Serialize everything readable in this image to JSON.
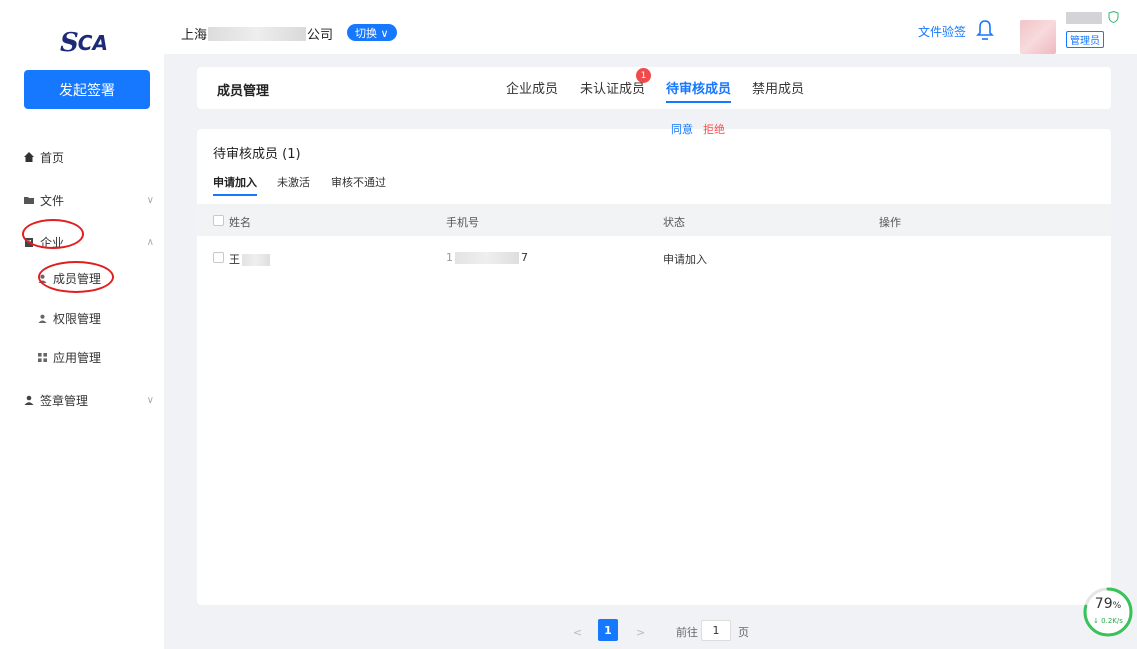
{
  "brand": {
    "logo_mark": "S",
    "logo_text": "CA"
  },
  "sidebar": {
    "start_button": "发起签署",
    "items": [
      {
        "label": "首页",
        "icon": "home-icon"
      },
      {
        "label": "文件",
        "icon": "folder-icon",
        "expand": "chevron-down-icon"
      },
      {
        "label": "企业",
        "icon": "building-icon",
        "expand": "chevron-up-icon"
      },
      {
        "label": "签章管理",
        "icon": "user-icon",
        "expand": "chevron-down-icon"
      }
    ],
    "sub_items": [
      {
        "label": "成员管理",
        "icon": "user-icon"
      },
      {
        "label": "权限管理",
        "icon": "user-icon"
      },
      {
        "label": "应用管理",
        "icon": "grid-icon"
      }
    ]
  },
  "header": {
    "company_prefix": "上海",
    "company_suffix": "公司",
    "switch_label": "切换 ∨",
    "file_verify": "文件验签",
    "role": "管理员"
  },
  "tabs_card": {
    "title": "成员管理",
    "tabs": [
      "企业成员",
      "未认证成员",
      "待审核成员",
      "禁用成员"
    ],
    "active_tab": "待审核成员",
    "badge": "1"
  },
  "panel": {
    "heading": "待审核成员 (1)",
    "subtabs": [
      "申请加入",
      "未激活",
      "审核不通过"
    ],
    "columns": [
      "姓名",
      "手机号",
      "状态",
      "操作"
    ],
    "rows": [
      {
        "name_visible": "王",
        "phone_prefix": "1",
        "phone_suffix": "7",
        "status": "申请加入",
        "agree": "同意",
        "reject": "拒绝"
      }
    ]
  },
  "pagination": {
    "prev": "<",
    "current": "1",
    "next": ">",
    "goto_label": "前往",
    "goto_value": "1",
    "page_unit": "页"
  },
  "net_widget": {
    "percent": "79",
    "percent_unit": "%",
    "speed": "↓ 0.2K/s"
  },
  "colors": {
    "primary": "#1677ff",
    "danger": "#ff4d4f",
    "annotation": "#e02020",
    "bg": "#f0f2f5"
  }
}
